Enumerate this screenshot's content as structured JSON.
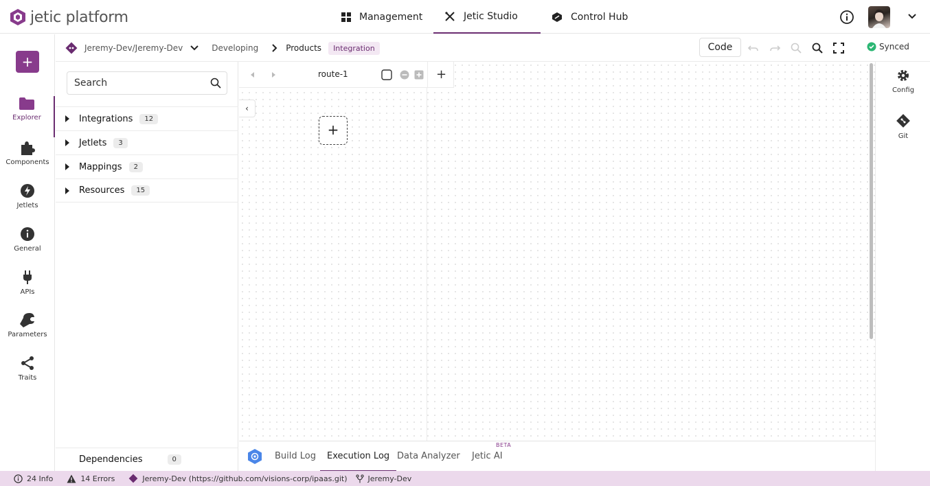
{
  "app": {
    "brand": "jetic platform"
  },
  "nav": [
    {
      "label": "Management",
      "icon": "grid-icon"
    },
    {
      "label": "Jetic Studio",
      "icon": "tools-icon",
      "active": true
    },
    {
      "label": "Control Hub",
      "icon": "hub-icon"
    }
  ],
  "rail": [
    {
      "label": "Explorer",
      "icon": "folder-icon",
      "active": true
    },
    {
      "label": "Components",
      "icon": "puzzle-icon"
    },
    {
      "label": "Jetlets",
      "icon": "bolt-icon"
    },
    {
      "label": "General",
      "icon": "info-icon"
    },
    {
      "label": "APIs",
      "icon": "plug-icon"
    },
    {
      "label": "Parameters",
      "icon": "wrench-icon"
    },
    {
      "label": "Traits",
      "icon": "share-icon"
    }
  ],
  "add_button": "+",
  "breadcrumb": {
    "repo": "Jeremy-Dev/Jeremy-Dev",
    "stage": "Developing",
    "project": "Products",
    "tag": "Integration"
  },
  "toolbar": {
    "code_label": "Code",
    "sync_status": "Synced"
  },
  "explorer": {
    "search_placeholder": "Search",
    "tree": [
      {
        "label": "Integrations",
        "count": "12"
      },
      {
        "label": "Jetlets",
        "count": "3"
      },
      {
        "label": "Mappings",
        "count": "2"
      },
      {
        "label": "Resources",
        "count": "15"
      }
    ],
    "dependencies": {
      "label": "Dependencies",
      "count": "0"
    }
  },
  "canvas": {
    "route_name": "route-1",
    "add_route": "+",
    "add_step": "+",
    "collapse": "‹"
  },
  "right_rail": [
    {
      "label": "Config",
      "icon": "gear-icon"
    },
    {
      "label": "Git",
      "icon": "git-icon"
    }
  ],
  "log_tabs": [
    {
      "label": "Build Log"
    },
    {
      "label": "Execution Log",
      "active": true
    },
    {
      "label": "Data Analyzer"
    },
    {
      "label": "Jetic AI",
      "badge": "BETA"
    }
  ],
  "status": {
    "info": "24 Info",
    "errors": "14 Errors",
    "repo": "Jeremy-Dev (https://github.com/visions-corp/ipaas.git)",
    "branch": "Jeremy-Dev"
  },
  "colors": {
    "accent": "#6a2c70",
    "add_button": "#883b8c",
    "status_bar": "#ecd9ec",
    "synced": "#2bb673"
  }
}
